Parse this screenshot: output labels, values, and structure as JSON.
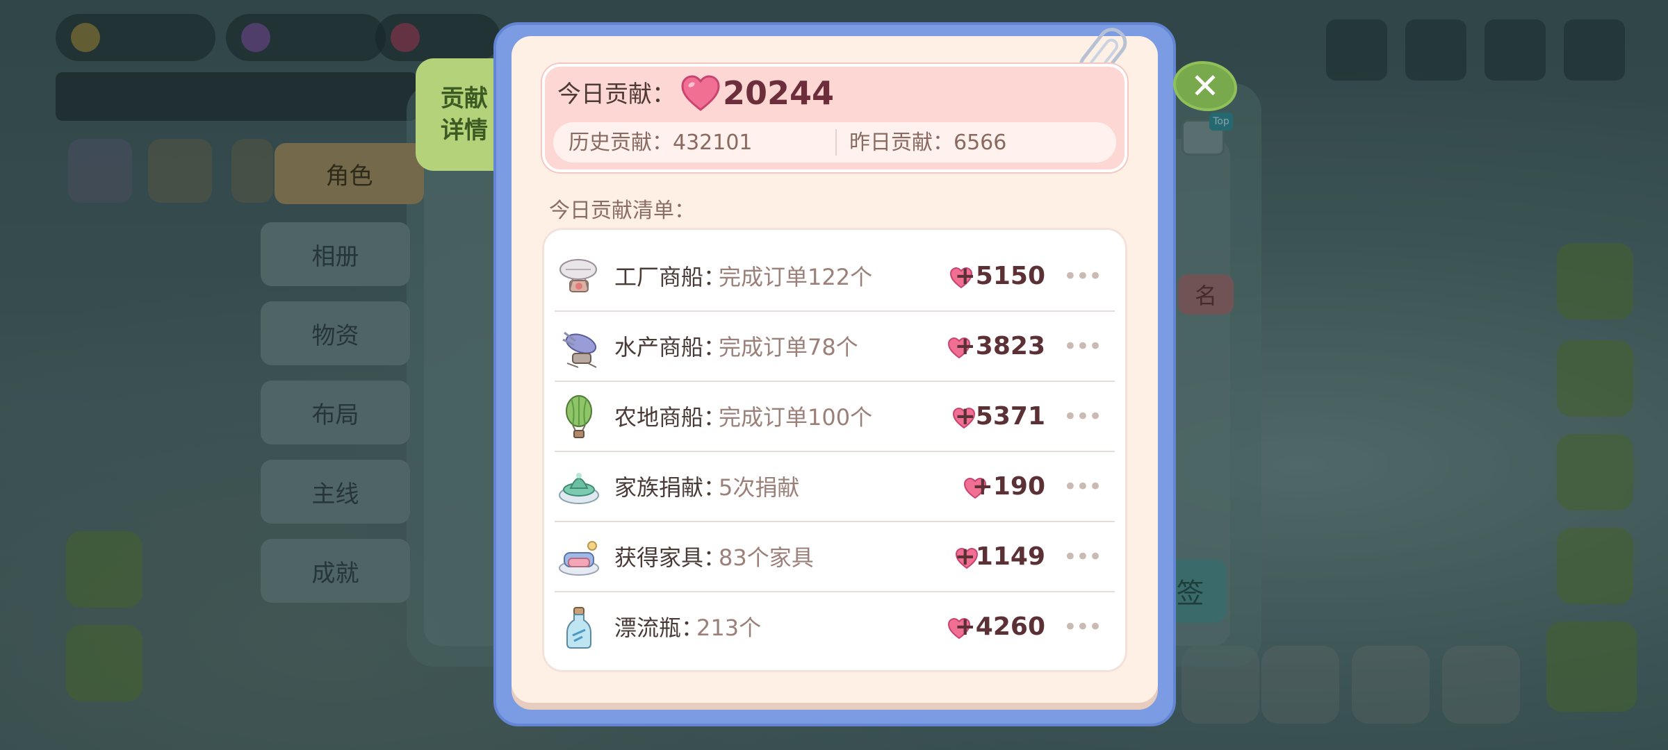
{
  "tab_label": [
    "贡献",
    "详情"
  ],
  "close_symbol": "✕",
  "summary": {
    "today_label": "今日贡献：",
    "today_value": "20244",
    "history_text": "历史贡献：432101",
    "yesterday_text": "昨日贡献：6566"
  },
  "list_title": "今日贡献清单：",
  "rows": [
    {
      "name": "工厂商船：",
      "desc": "完成订单122个",
      "value": "+5150",
      "icon": "airship-icon"
    },
    {
      "name": "水产商船：",
      "desc": "完成订单78个",
      "value": "+3823",
      "icon": "fish-airship-icon"
    },
    {
      "name": "农地商船：",
      "desc": "完成订单100个",
      "value": "+5371",
      "icon": "balloon-icon"
    },
    {
      "name": "家族捐献：",
      "desc": "5次捐献",
      "value": "+190",
      "icon": "fountain-icon"
    },
    {
      "name": "获得家具：",
      "desc": "83个家具",
      "value": "+1149",
      "icon": "sofa-icon"
    },
    {
      "name": "漂流瓶：",
      "desc": "213个",
      "value": "+4260",
      "icon": "bottle-icon"
    }
  ],
  "more_symbol": "•••",
  "background": {
    "menu": [
      "角色",
      "相册",
      "物资",
      "布局",
      "主线",
      "成就"
    ],
    "rank_tag": "名",
    "right_button": "签",
    "top_badge": "Top"
  },
  "colors": {
    "dialog_frame": "#7b9ce2",
    "paper": "#fff0e6",
    "heart": "#f06f93",
    "tab_green": "#b4d27a",
    "value_text": "#5b3136"
  }
}
